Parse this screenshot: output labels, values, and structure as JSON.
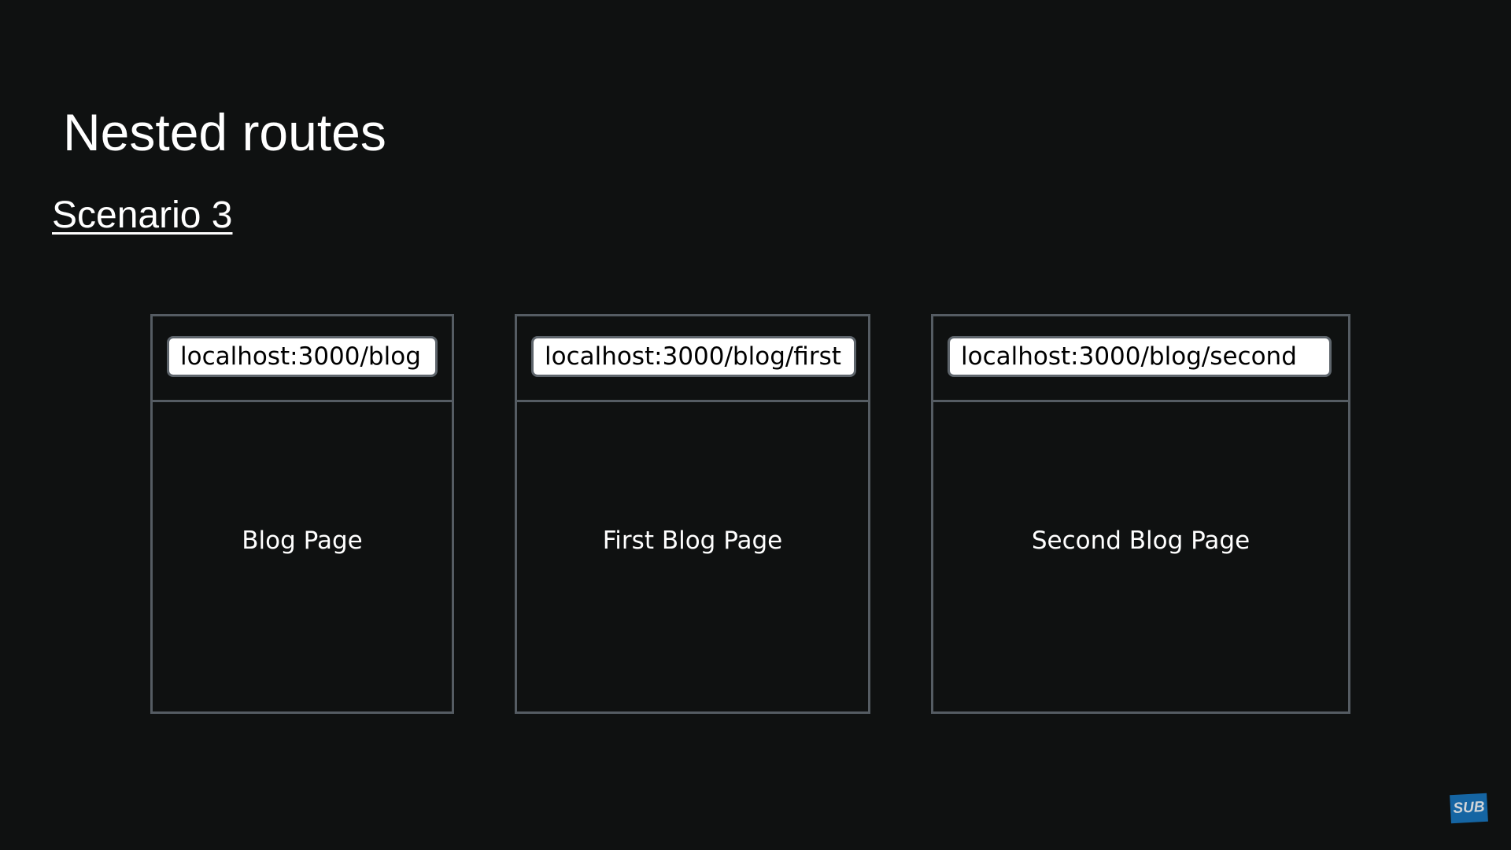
{
  "slide": {
    "title": "Nested routes",
    "subtitle": "Scenario 3"
  },
  "frames": [
    {
      "url": "localhost:3000/blog",
      "label": "Blog Page"
    },
    {
      "url": "localhost:3000/blog/first",
      "label": "First Blog Page"
    },
    {
      "url": "localhost:3000/blog/second",
      "label": "Second Blog Page"
    }
  ],
  "logo": {
    "text": "SUB",
    "color": "#1565a3"
  }
}
